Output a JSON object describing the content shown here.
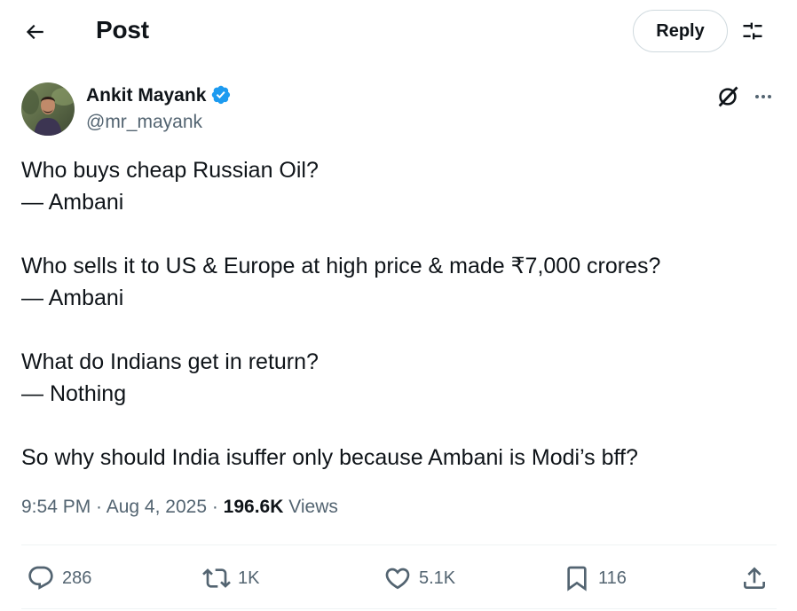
{
  "header": {
    "title": "Post",
    "reply_label": "Reply",
    "back_icon": "arrow-left-icon",
    "filter_icon": "sliders-icon"
  },
  "author": {
    "name": "Ankit Mayank",
    "handle": "@mr_mayank",
    "verified": true,
    "verified_color": "#1d9bf0"
  },
  "tweet": {
    "lines": [
      "Who buys cheap Russian Oil?",
      "— Ambani",
      "",
      "Who sells it to US & Europe at high price & made ₹7,000 crores?",
      "— Ambani",
      "",
      "What do Indians get in return?",
      "— Nothing",
      "",
      "So why should India isuffer only because Ambani is Modi’s bff?"
    ],
    "time": "9:54 PM",
    "separator": " · ",
    "date": "Aug 4, 2025",
    "views_count": "196.6K",
    "views_label": "Views"
  },
  "actions": {
    "replies": "286",
    "reposts": "1K",
    "likes": "5.1K",
    "bookmarks": "116"
  },
  "colors": {
    "text": "#0f1419",
    "secondary": "#536471",
    "border": "#eff3f4",
    "accent": "#1d9bf0"
  }
}
